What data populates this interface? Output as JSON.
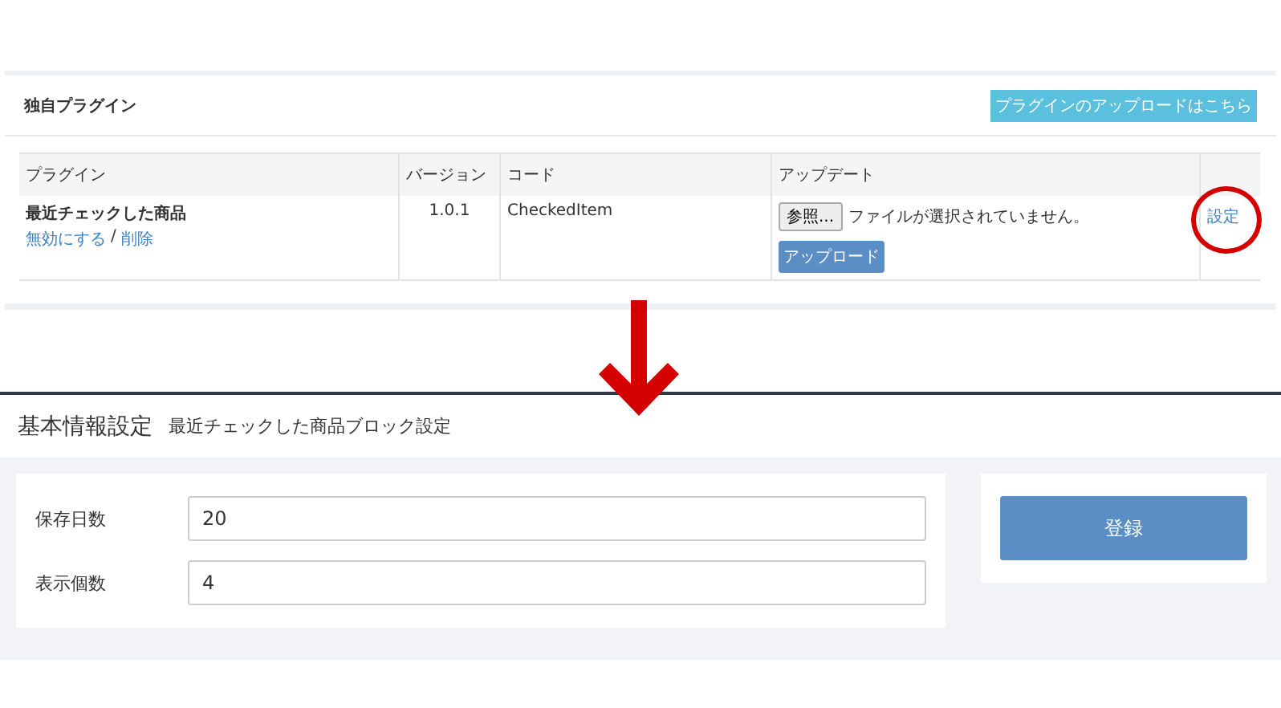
{
  "plugin_panel": {
    "title": "独自プラグイン",
    "upload_link": "プラグインのアップロードはこちら",
    "columns": [
      "プラグイン",
      "バージョン",
      "コード",
      "アップデート"
    ],
    "rows": [
      {
        "name": "最近チェックした商品",
        "disable_link": "無効にする",
        "separator": "/",
        "delete_link": "削除",
        "version": "1.0.1",
        "code": "CheckedItem",
        "browse_button": "参照...",
        "file_status": "ファイルが選択されていません。",
        "upload_button": "アップロード",
        "settings_link": "設定",
        "highlighted": true
      }
    ]
  },
  "settings_page": {
    "title": "基本情報設定",
    "subtitle": "最近チェックした商品ブロック設定",
    "fields": [
      {
        "label": "保存日数",
        "value": "20"
      },
      {
        "label": "表示個数",
        "value": "4"
      }
    ],
    "register_button": "登録"
  }
}
